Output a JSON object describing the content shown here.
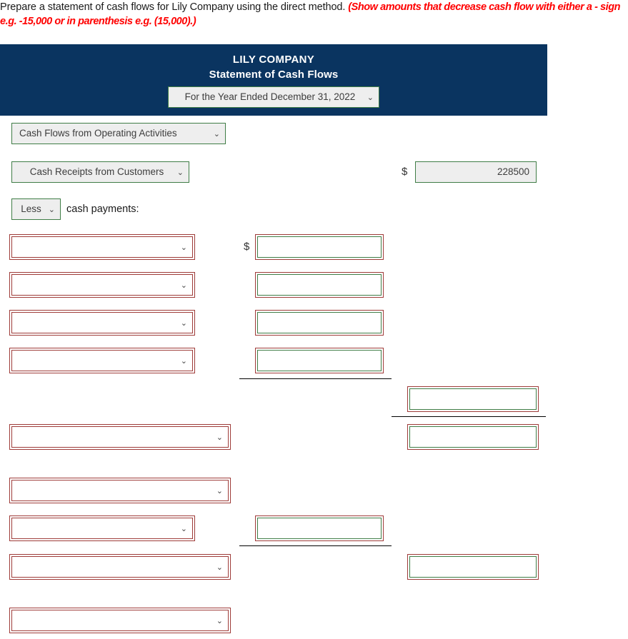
{
  "instruction": {
    "main": "Prepare a statement of cash flows for Lily Company using the direct method.",
    "hint": "(Show amounts that decrease cash flow with either a - sign e.g. -15,000 or in parenthesis e.g. (15,000).)"
  },
  "header": {
    "company": "LILY COMPANY",
    "title": "Statement of Cash Flows",
    "period": "For the Year Ended December 31, 2022",
    "background_color": "#0a3460",
    "text_color": "#ffffff"
  },
  "colors": {
    "filled_border": "#3f7d46",
    "filled_background": "#eeeeee",
    "empty_border": "#9e3b38",
    "rule": "#000000",
    "hint_text": "#ff0000"
  },
  "icons": {
    "chevron": "⌄"
  },
  "rows": {
    "section_header": {
      "label": "Cash Flows from Operating Activities",
      "state": "filled"
    },
    "receipts": {
      "label": "Cash Receipts from Customers",
      "state": "filled",
      "currency": "$",
      "amount": "228500"
    },
    "less": {
      "label": "Less",
      "state": "filled",
      "trailing_text": "cash payments:"
    },
    "payment_1": {
      "label": "",
      "state": "empty",
      "currency": "$",
      "amount": ""
    },
    "payment_2": {
      "label": "",
      "state": "empty",
      "amount": ""
    },
    "payment_3": {
      "label": "",
      "state": "empty",
      "amount": ""
    },
    "payment_4": {
      "label": "",
      "state": "empty",
      "amount": ""
    },
    "payments_total": {
      "amount": "",
      "state": "empty"
    },
    "net_operating": {
      "label": "",
      "state": "empty",
      "amount": ""
    },
    "investing_header": {
      "label": "",
      "state": "empty"
    },
    "investing_item": {
      "label": "",
      "state": "empty",
      "amount": ""
    },
    "net_investing": {
      "label": "",
      "state": "empty",
      "amount": ""
    },
    "financing_header": {
      "label": "",
      "state": "empty"
    }
  }
}
